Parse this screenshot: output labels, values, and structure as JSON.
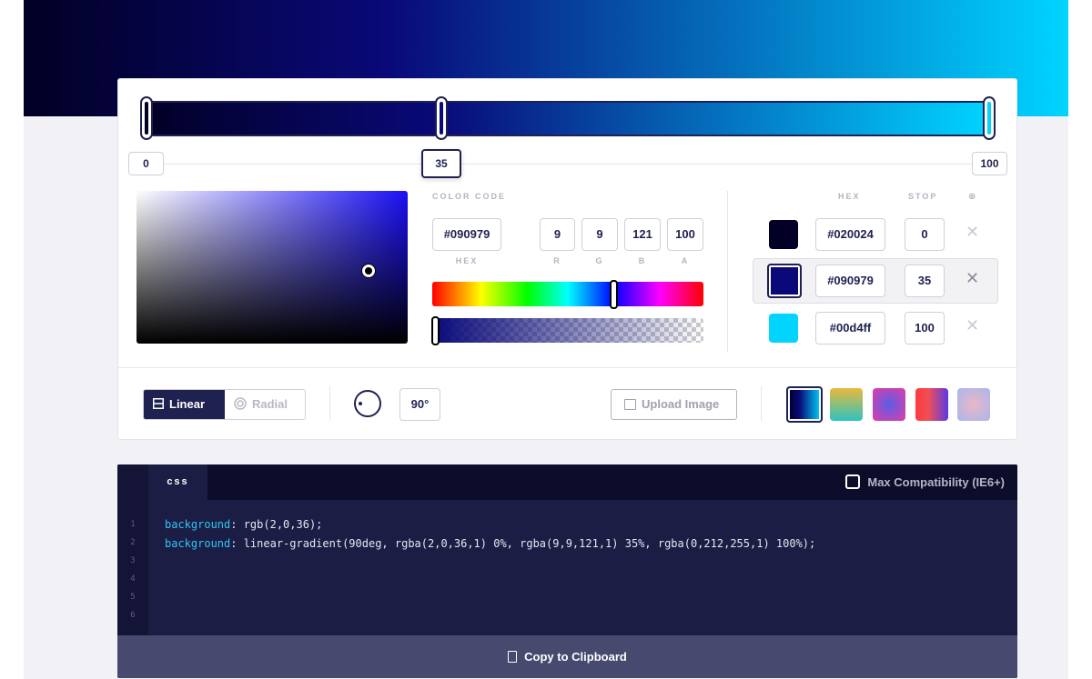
{
  "editor": {
    "stops_positions": [
      "0",
      "35",
      "100"
    ],
    "color_code_label": "COLOR CODE",
    "hex_value": "#090979",
    "r": "9",
    "g": "9",
    "b": "121",
    "a": "100",
    "hex_label": "HEX",
    "r_label": "R",
    "g_label": "G",
    "b_label": "B",
    "a_label": "A",
    "hue_level": 0.67,
    "alpha_level": 1.0
  },
  "stops_table": {
    "hex_header": "HEX",
    "stop_header": "STOP",
    "add_icon": "⊕",
    "rows": [
      {
        "hex": "#020024",
        "stop": "0",
        "color": "#020024"
      },
      {
        "hex": "#090979",
        "stop": "35",
        "color": "#090979"
      },
      {
        "hex": "#00d4ff",
        "stop": "100",
        "color": "#00d4ff"
      }
    ],
    "delete_icon": "✕"
  },
  "toolbar": {
    "linear_label": "Linear",
    "radial_label": "Radial",
    "angle_value": "90°",
    "upload_label": "Upload Image"
  },
  "code": {
    "tab_label": "css",
    "compat_label": "Max Compatibility (IE6+)",
    "line_numbers": [
      "1",
      "2",
      "3",
      "4",
      "5",
      "6"
    ],
    "line1_prop": "background",
    "line1_value": ": rgb(2,0,36);",
    "line2_prop": "background",
    "line2_value": ": linear-gradient(90deg, rgba(2,0,36,1) 0%, rgba(9,9,121,1) 35%, rgba(0,212,255,1) 100%);",
    "copy_label": "Copy to Clipboard"
  },
  "colors": {
    "accent": "#1f2150",
    "gradient_start": "#020024",
    "gradient_mid": "#090979",
    "gradient_end": "#00d4ff"
  }
}
